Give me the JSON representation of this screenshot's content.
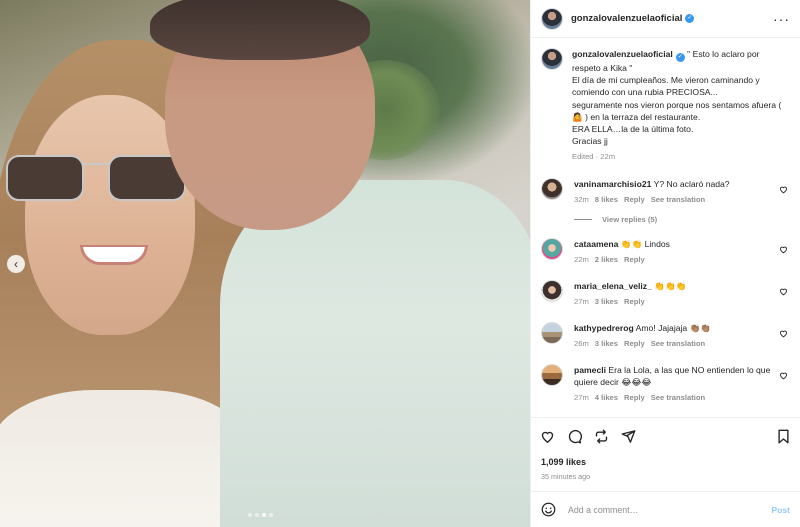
{
  "post": {
    "author": "gonzalovalenzuelaoficial",
    "caption_lines": [
      "\" Esto lo aclaro por respeto a Kika \"",
      "El día de mi cumpleaños. Me vieron caminando y comiendo con una rubia PRECIOSA...",
      "seguramente nos vieron porque nos sentamos afuera ( 🤷 ) en la terraza del restaurante.",
      "ERA ELLA…la de la última foto.",
      "Gracias jj"
    ],
    "caption_meta": "Edited · 22m",
    "likes": "1,099 likes",
    "time_ago": "35 minutes ago"
  },
  "photo": {
    "prev_icon": "chevron-left-icon",
    "carousel_dots": 4
  },
  "comments": [
    {
      "user": "vaninamarchisio21",
      "text": "Y? No aclaró nada?",
      "time": "32m",
      "likes": "8 likes",
      "reply": "Reply",
      "translate": "See translation",
      "view_replies": "View replies (5)"
    },
    {
      "user": "cataamena",
      "text": "👏👏 Lindos",
      "time": "22m",
      "likes": "2 likes",
      "reply": "Reply"
    },
    {
      "user": "maria_elena_veliz_",
      "text": "👏👏👏",
      "time": "27m",
      "likes": "3 likes",
      "reply": "Reply"
    },
    {
      "user": "kathypedrerog",
      "text": "Amo! Jajajaja 👏🏽👏🏽",
      "time": "26m",
      "likes": "3 likes",
      "reply": "Reply",
      "translate": "See translation"
    },
    {
      "user": "pamecli",
      "text": "Era la Lola, a las que NO entienden lo que quiere decir 😂😂😂",
      "time": "27m",
      "likes": "4 likes",
      "reply": "Reply",
      "translate": "See translation"
    }
  ],
  "composer": {
    "placeholder": "Add a comment…",
    "post_label": "Post"
  },
  "colors": {
    "accent": "#0095f6",
    "post_disabled": "#95c8f8",
    "muted": "#8e8e8e"
  }
}
